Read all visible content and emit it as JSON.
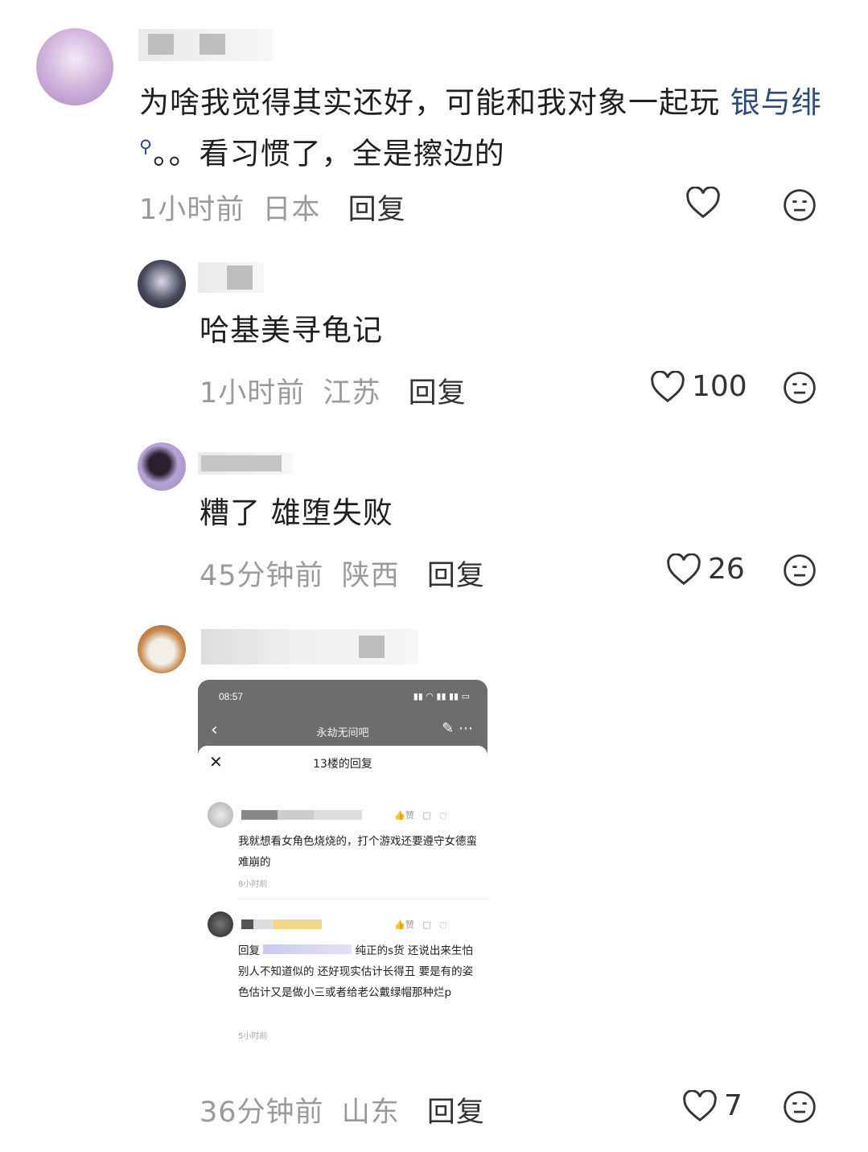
{
  "comments": [
    {
      "text_main": "为啥我觉得其实还好，可能和我对象一起玩",
      "link": "银与绯",
      "text_after": "。。看习惯了，全是擦边的",
      "time": "1小时前",
      "location": "日本",
      "reply": "回复",
      "likes": ""
    },
    {
      "text": "哈基美寻龟记",
      "time": "1小时前",
      "location": "江苏",
      "reply": "回复",
      "likes": "100"
    },
    {
      "text": "糟了 雄堕失败",
      "time": "45分钟前",
      "location": "陕西",
      "reply": "回复",
      "likes": "26"
    },
    {
      "time": "36分钟前",
      "location": "山东",
      "reply": "回复",
      "likes": "7"
    }
  ],
  "embedded": {
    "status_time": "08:57",
    "forum": "永劫无间吧",
    "panel_title": "13楼的回复",
    "like_label": "赞",
    "item1_text": "我就想看女角色烧烧的，打个游戏还要遵守女德蛮难崩的",
    "item1_time": "8小时前",
    "item2_text_prefix": "回复",
    "item2_text": "纯正的s货 还说出来生怕别人不知道似的 还好现实估计长得丑 要是有的姿色估计又是做小三或者给老公戴绿帽那种烂p",
    "item2_time": "5小时前"
  },
  "colors": {
    "link": "#2d4a7a",
    "meta": "#9a9a9a"
  }
}
